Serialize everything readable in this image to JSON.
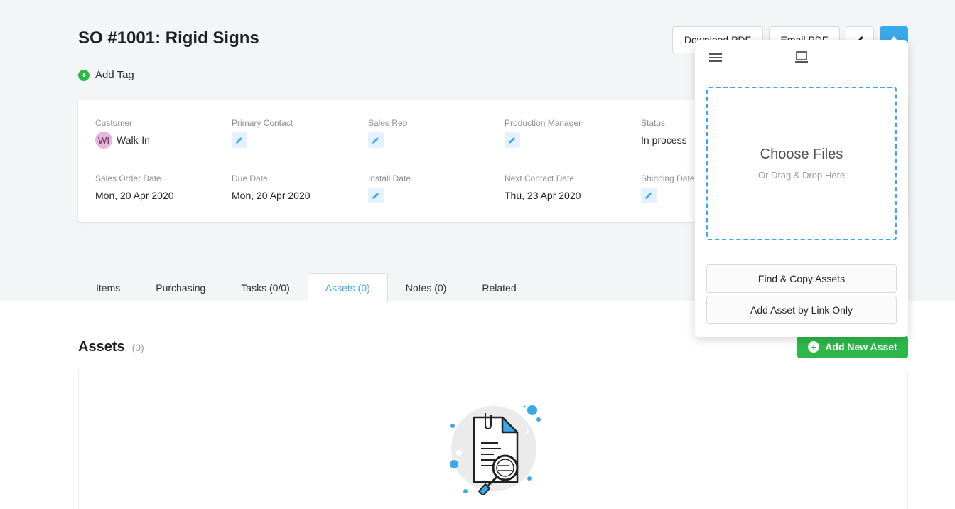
{
  "header": {
    "title": "SO #1001: Rigid Signs",
    "add_tag_label": "Add Tag",
    "download_pdf_label": "Download PDF",
    "email_pdf_label": "Email PDF"
  },
  "details": {
    "customer": {
      "label": "Customer",
      "value": "Walk-In",
      "avatar_initials": "WI"
    },
    "primary_contact": {
      "label": "Primary Contact"
    },
    "sales_rep": {
      "label": "Sales Rep"
    },
    "production_manager": {
      "label": "Production Manager"
    },
    "status": {
      "label": "Status",
      "value": "In process"
    },
    "sales_order_date": {
      "label": "Sales Order Date",
      "value": "Mon, 20 Apr 2020"
    },
    "due_date": {
      "label": "Due Date",
      "value": "Mon, 20 Apr 2020"
    },
    "install_date": {
      "label": "Install Date"
    },
    "next_contact_date": {
      "label": "Next Contact Date",
      "value": "Thu, 23 Apr 2020"
    },
    "shipping_date": {
      "label": "Shipping Date"
    }
  },
  "tabs": [
    {
      "label": "Items",
      "active": false
    },
    {
      "label": "Purchasing",
      "active": false
    },
    {
      "label": "Tasks (0/0)",
      "active": false
    },
    {
      "label": "Assets (0)",
      "active": true
    },
    {
      "label": "Notes (0)",
      "active": false
    },
    {
      "label": "Related",
      "active": false
    }
  ],
  "assets": {
    "title": "Assets",
    "count": "(0)",
    "add_new_label": "Add New Asset"
  },
  "upload_popover": {
    "choose_files": "Choose Files",
    "drag_drop": "Or Drag & Drop Here",
    "find_copy_label": "Find & Copy Assets",
    "add_by_link_label": "Add Asset by Link Only"
  },
  "colors": {
    "accent": "#3aa9ea",
    "success": "#2eb84b",
    "page_bg": "#f4f5f6"
  },
  "icons": {
    "add_tag": "plus-circle-icon",
    "edit": "pencil-icon",
    "upload": "upload-icon",
    "menu": "hamburger-menu-icon",
    "computer": "laptop-icon",
    "empty_state": "document-search-icon"
  }
}
